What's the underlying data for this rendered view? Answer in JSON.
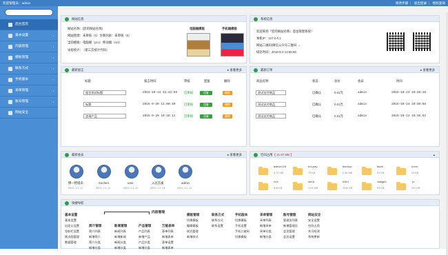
{
  "topbar": {
    "welcome": "欢迎管理员：admin",
    "links": [
      "修改手册",
      "退出登录",
      "授权查询"
    ]
  },
  "sidebar": {
    "items": [
      {
        "label": "后台首页",
        "active": true
      },
      {
        "label": "基本设置"
      },
      {
        "label": "内容管理"
      },
      {
        "label": "模板管理"
      },
      {
        "label": "联系方式"
      },
      {
        "label": "手机版本"
      },
      {
        "label": "采单管理"
      },
      {
        "label": "账号管理"
      },
      {
        "label": "网站安全"
      }
    ]
  },
  "info": {
    "title": "网站信息",
    "lines": [
      "网站名称：[您的网站名称]",
      "网站管理：未审核（0）文章列表：未审核（0）",
      "当前模板：电脑端（pc1）移动端（m1）",
      "访客统计：",
      "（第三方统计代码）"
    ],
    "pc_label": "电脑端模板",
    "m_label": "手机端模板"
  },
  "sys": {
    "title": "系统信息",
    "lines": [
      "欢迎来到『您的网站名称』后台管理系统！",
      "本机IP：127.0.0.1",
      "网站二维码/微信公众号二维码 →",
      "域名时间：2016-9-3 13:55:50"
    ]
  },
  "msg": {
    "title": "最新留言",
    "more": "查看更多",
    "headers": [
      "标题",
      "留言时间",
      "审核",
      "回复",
      "删除"
    ],
    "rows": [
      {
        "title": "留言测试标题",
        "time": "2015-10-24 12:42:59",
        "status": "已审核",
        "reply": "回复",
        "del": "删除"
      },
      {
        "title": "标题",
        "time": "2015-9-30 11:00:40",
        "status": "已审核",
        "reply": "回复",
        "del": "删除"
      },
      {
        "title": "咨询产品",
        "time": "2015-9-29 10:18:11",
        "status": "已审核",
        "reply": "回复",
        "del": "删除"
      }
    ]
  },
  "order": {
    "title": "最新订单",
    "more": "查看更多",
    "headers": [
      "商品名称",
      "状态",
      "总价",
      "会员",
      "时间"
    ],
    "rows": [
      {
        "name": "测试支付商品",
        "status": "已确认",
        "price": "0.01元",
        "member": "admin",
        "time": "2015-10-24 19:40:18"
      },
      {
        "name": "测试支付商品",
        "status": "已确认",
        "price": "0.01元",
        "member": "admin",
        "time": "2015-10-24 19:39:58"
      },
      {
        "name": "测试支付商品",
        "status": "已确认",
        "price": "0.01元",
        "member": "admin",
        "time": "2015-10-24 19:36:52"
      }
    ]
  },
  "members": {
    "title": "最新会员",
    "more": "查看更多",
    "list": [
      {
        "name": "撑一把纸伞",
        "date": "2015-11-11"
      },
      {
        "name": "Xochen",
        "date": "2015-11-11"
      },
      {
        "name": "user",
        "date": "2015-11-11"
      },
      {
        "name": "入驻方桌",
        "date": "2015-11-11"
      },
      {
        "name": "admin",
        "date": "2015-11-11"
      }
    ]
  },
  "space": {
    "title": "空间占用",
    "size": "【 21.97 MB 】",
    "folders": [
      {
        "name": "admin123",
        "size": "3.72 MB"
      },
      {
        "name": "alipay",
        "size": "79 KB"
      },
      {
        "name": "backup",
        "size": "0.96 MB"
      },
      {
        "name": "bank",
        "size": "51 KB"
      },
      {
        "name": "conn",
        "size": "23 KB"
      },
      {
        "name": "css",
        "size": "618 KB"
      },
      {
        "name": "data",
        "size": "1.04 MB"
      },
      {
        "name": "html",
        "size": "1015 KB"
      },
      {
        "name": "images",
        "size": "54 KB"
      },
      {
        "name": "js",
        "size": "321 KB"
      }
    ]
  },
  "nav": {
    "title": "快捷导航",
    "big": "内容管理",
    "cols": [
      {
        "h": "基本设置",
        "items": [
          "基本设置",
          "自定义设置",
          "导航栏设置",
          "焦点图管理",
          "数据管理"
        ]
      },
      {
        "h": "简介管理",
        "items": [
          "简介列表",
          "新增简介",
          "简介分类",
          "新增分类"
        ]
      },
      {
        "h": "新闻管理",
        "items": [
          "新闻列表",
          "新增新闻",
          "新闻分类",
          "新增分类"
        ]
      },
      {
        "h": "产品管理",
        "items": [
          "产品列表",
          "新增产品",
          "产品分类",
          "新增分类"
        ]
      },
      {
        "h": "万能表单",
        "items": [
          "表单列表",
          "新增表单",
          "表单设置",
          "新增表单"
        ]
      },
      {
        "h": "模板管理",
        "items": [
          "切换模板",
          "编辑模板",
          "样式管理",
          "新增样式"
        ]
      },
      {
        "h": "联系方式",
        "items": [
          "联系方式",
          "联系设置"
        ]
      },
      {
        "h": "手机版本",
        "items": [
          "切换模板",
          "手机设置",
          "手机二维码",
          "切换模板"
        ]
      },
      {
        "h": "采单管理",
        "items": [
          "采单列表",
          "新增采单",
          "采单分类",
          "新增分类"
        ]
      },
      {
        "h": "账号管理",
        "items": [
          "管理员列表",
          "新增管理员",
          "会员管理",
          "会员设置"
        ]
      },
      {
        "h": "网站安全",
        "items": [
          "安全设置",
          "空间占用",
          "木马检测",
          "系统更新"
        ]
      }
    ]
  }
}
